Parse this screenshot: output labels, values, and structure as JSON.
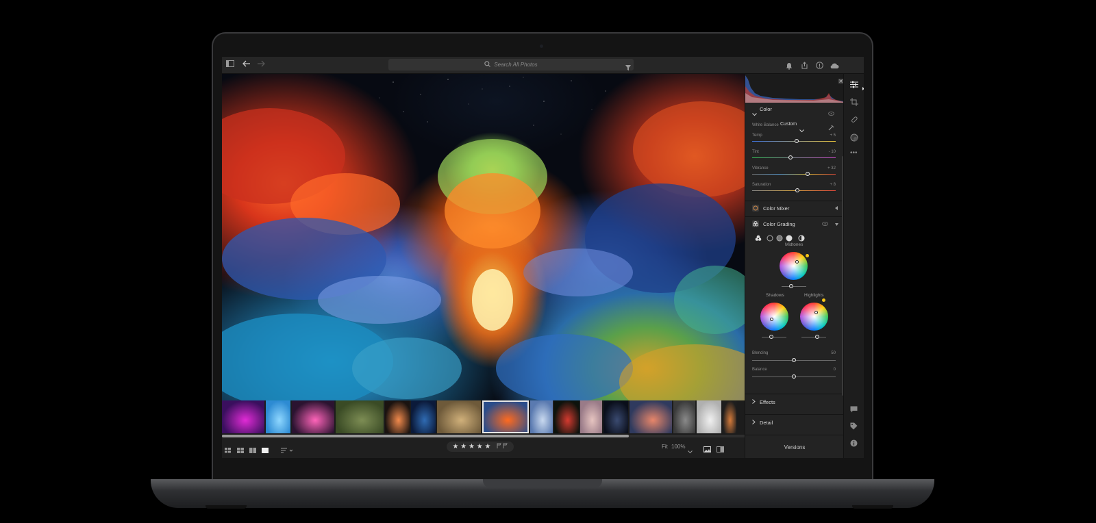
{
  "topbar": {
    "search_placeholder": "Search All Photos",
    "icons": [
      "sidebar-toggle-icon",
      "back-arrow-icon",
      "forward-arrow-icon",
      "search-icon",
      "filter-icon",
      "bell-icon",
      "share-icon",
      "help-icon",
      "cloud-icon"
    ]
  },
  "filmstrip": {
    "thumbs": [
      {
        "color": "#3a0f5e",
        "accent": "#e12bd6",
        "w": 62
      },
      {
        "color": "#2d8bd3",
        "accent": "#8fd7ff",
        "w": 36
      },
      {
        "color": "#2b1330",
        "accent": "#ff64ba",
        "w": 62
      },
      {
        "color": "#3a4b25",
        "accent": "#7d8d54",
        "w": 70
      },
      {
        "color": "#1a1310",
        "accent": "#f28a4c",
        "w": 36
      },
      {
        "color": "#0b1a3a",
        "accent": "#2f6bb3",
        "w": 36
      },
      {
        "color": "#6e5a3a",
        "accent": "#d0b07a",
        "w": 64
      },
      {
        "color": "#2b4d8a",
        "accent": "#ff6a1f",
        "w": 68,
        "selected": true
      },
      {
        "color": "#5a7ab0",
        "accent": "#c9d9ef",
        "w": 33
      },
      {
        "color": "#0d130d",
        "accent": "#d43a2f",
        "w": 36
      },
      {
        "color": "#9a7b88",
        "accent": "#e6c4c0",
        "w": 32
      },
      {
        "color": "#0a0e1a",
        "accent": "#3a4a70",
        "w": 36
      },
      {
        "color": "#2f3a5e",
        "accent": "#e8866a",
        "w": 62
      },
      {
        "color": "#3a3a3a",
        "accent": "#8a8a8a",
        "w": 32
      },
      {
        "color": "#b0b0b0",
        "accent": "#f0f0f0",
        "w": 36
      },
      {
        "color": "#1e1e1e",
        "accent": "#d47a3a",
        "w": 20
      }
    ]
  },
  "bottombar": {
    "stars": "★ ★ ★ ★ ★",
    "fit_label": "Fit",
    "zoom_label": "100%"
  },
  "panel": {
    "color_section": "Color",
    "white_balance_label": "White Balance",
    "white_balance_value": "Custom",
    "sliders": [
      {
        "name": "Temp",
        "value": "+ 5",
        "pos": 0.53
      },
      {
        "name": "Tint",
        "value": "- 10",
        "pos": 0.46
      },
      {
        "name": "Vibrance",
        "value": "+ 32",
        "pos": 0.66
      },
      {
        "name": "Saturation",
        "value": "+ 8",
        "pos": 0.54
      }
    ],
    "color_mixer_label": "Color Mixer",
    "color_grading_label": "Color Grading",
    "midtones_label": "Midtones",
    "shadows_label": "Shadows",
    "highlights_label": "Highlights",
    "blending_label": "Blending",
    "blending_value": "50",
    "balance_label": "Balance",
    "balance_value": "0",
    "effects_label": "Effects",
    "detail_label": "Detail",
    "versions_label": "Versions"
  },
  "colors": {
    "panel_bg": "#232323",
    "accent_yellow": "#f5c518"
  }
}
